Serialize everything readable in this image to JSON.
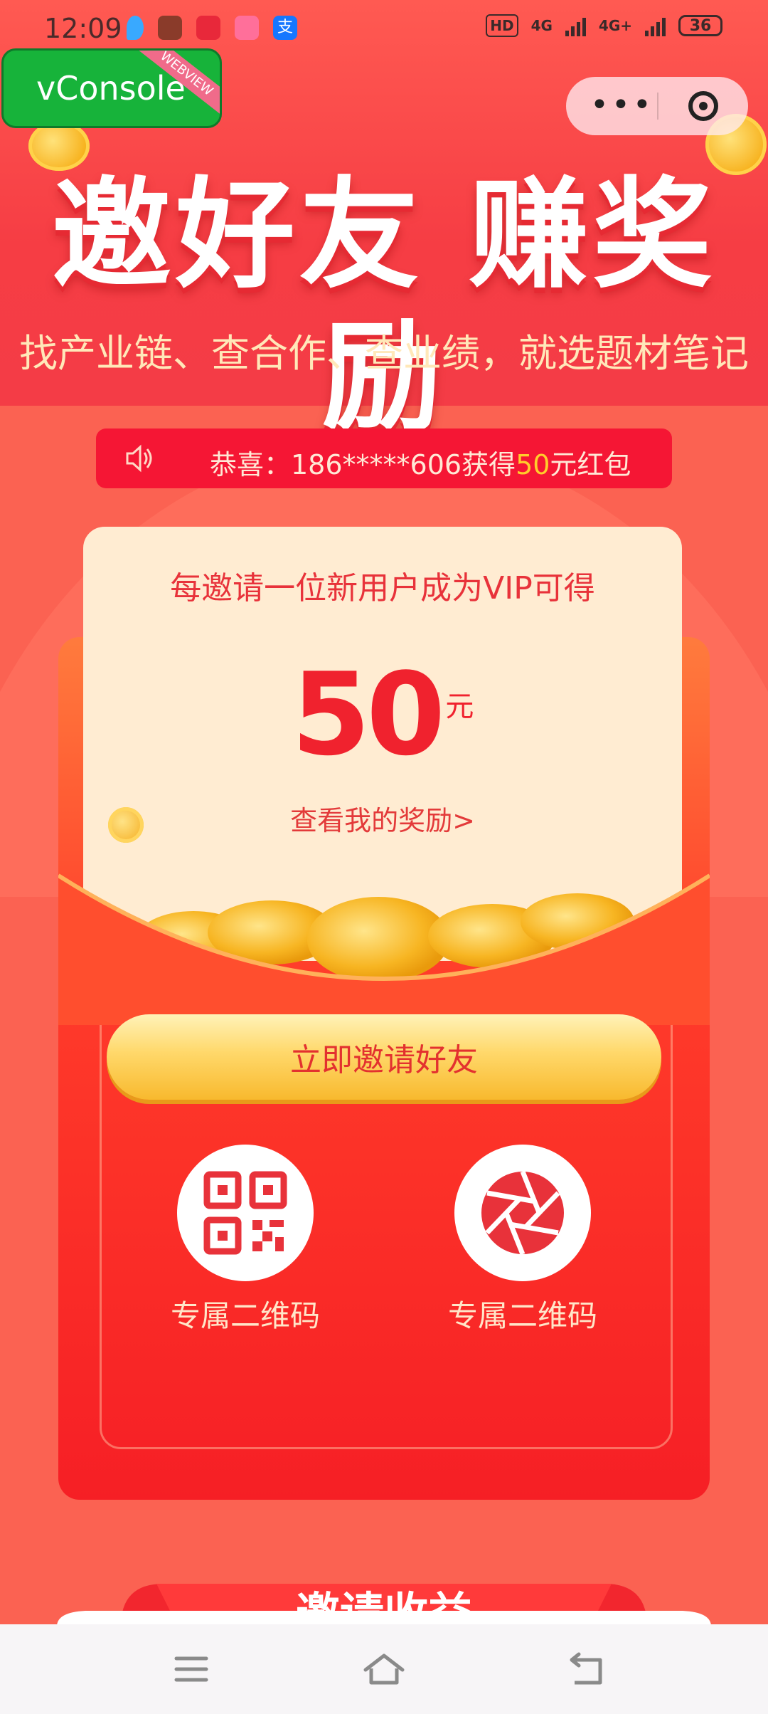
{
  "status_bar": {
    "time": "12:09",
    "hd_badge": "HD",
    "sim1": "4G",
    "sim2": "4G+",
    "battery": "36"
  },
  "vconsole": {
    "label": "vConsole",
    "ribbon": "WEBVIEW"
  },
  "header": {
    "title": "邀好友 赚奖励",
    "subtitle": "找产业链、查合作、查业绩，就选题材笔记"
  },
  "notice": {
    "prefix": "恭喜：186*****606获得",
    "amount": "50",
    "suffix": "元红包"
  },
  "reward_card": {
    "headline": "每邀请一位新用户成为VIP可得",
    "amount": "50",
    "unit": "元",
    "link": "查看我的奖励>"
  },
  "invite_button": {
    "label": "立即邀请好友"
  },
  "share_options": [
    {
      "label": "专属二维码",
      "icon": "qr-code-icon"
    },
    {
      "label": "专属二维码",
      "icon": "camera-aperture-icon"
    }
  ],
  "next_section": {
    "title": "邀请收益"
  },
  "colors": {
    "primary_red": "#f63d44",
    "button_gold": "#ffd86a",
    "vconsole_green": "#17b33a"
  }
}
